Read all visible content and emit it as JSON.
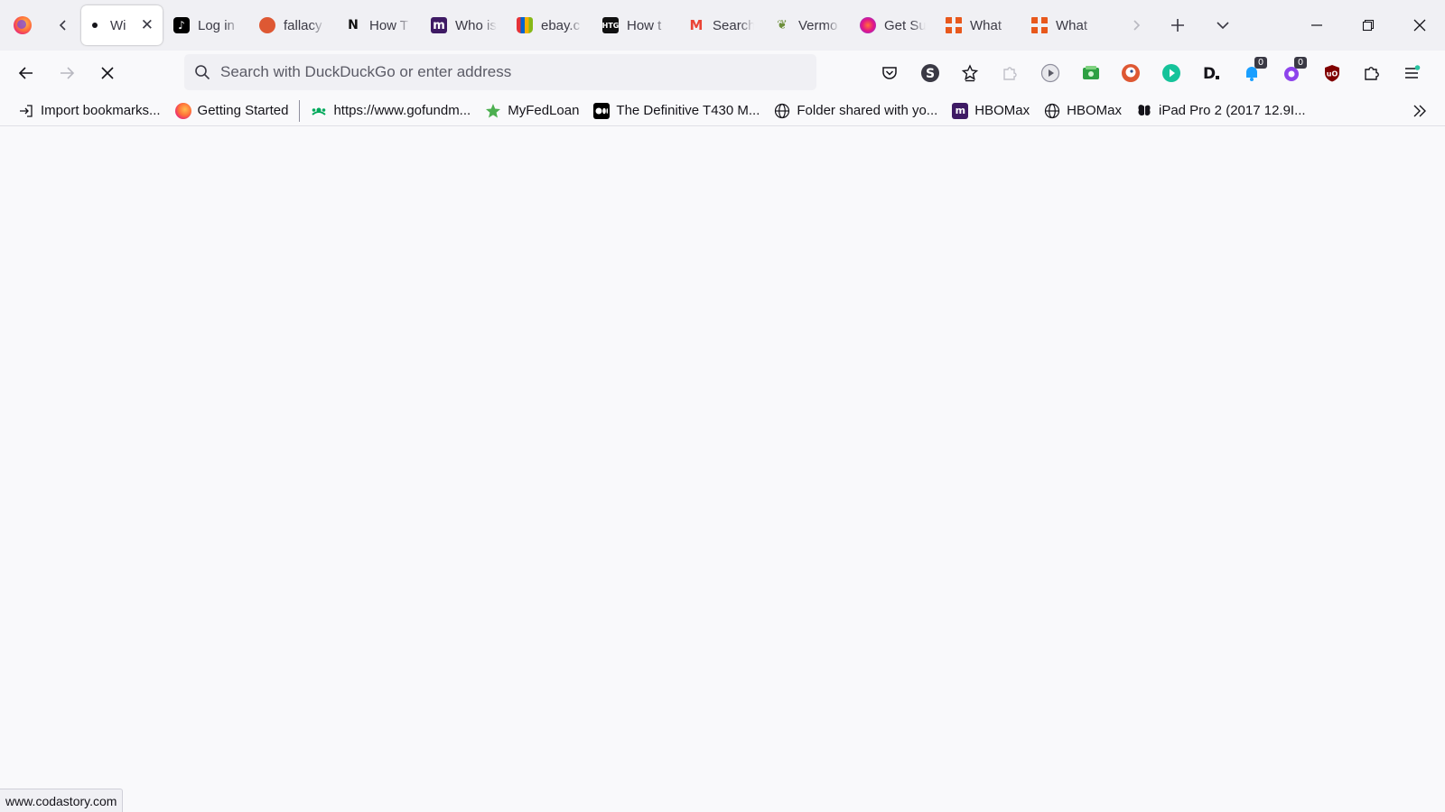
{
  "tabstrip": {
    "tabs": [
      {
        "title": "Wi",
        "active": true
      },
      {
        "title": "Log in",
        "icon": "tiktok-icon"
      },
      {
        "title": "fallacy",
        "icon": "duckduckgo-icon"
      },
      {
        "title": "How T",
        "icon": "nyt-icon"
      },
      {
        "title": "Who is",
        "icon": "meetup-icon"
      },
      {
        "title": "ebay.c",
        "icon": "ebay-icon"
      },
      {
        "title": "How t",
        "icon": "howtogeek-icon"
      },
      {
        "title": "Search",
        "icon": "gmail-icon"
      },
      {
        "title": "Vermo",
        "icon": "vermont-icon"
      },
      {
        "title": "Get Su",
        "icon": "firefox-icon"
      },
      {
        "title": "What",
        "icon": "grid-icon"
      },
      {
        "title": "What",
        "icon": "grid-icon"
      }
    ]
  },
  "favicons": {
    "tiktok": "♪",
    "nyt": "N",
    "meetup": "m",
    "htg": "HTG",
    "gmail": "M",
    "verm": "❦"
  },
  "navbar": {
    "url_placeholder": "Search with DuckDuckGo or enter address",
    "extension_badges": [
      "0",
      "0"
    ]
  },
  "bookmarks": [
    {
      "label": "Import bookmarks...",
      "icon": "import-icon"
    },
    {
      "label": "Getting Started",
      "icon": "firefox-icon"
    },
    {
      "label": "https://www.gofundm...",
      "icon": "gofundme-icon"
    },
    {
      "label": "MyFedLoan",
      "icon": "star-icon"
    },
    {
      "label": "The Definitive T430 M...",
      "icon": "medium-icon"
    },
    {
      "label": "Folder shared with yo...",
      "icon": "globe-icon"
    },
    {
      "label": "HBOMax",
      "icon": "meetup-icon"
    },
    {
      "label": "HBOMax",
      "icon": "globe-icon"
    },
    {
      "label": "iPad Pro 2 (2017 12.9I...",
      "icon": "butterfly-icon"
    }
  ],
  "status": {
    "url": "www.codastory.com"
  },
  "colors": {
    "tabstrip_bg": "#f0f0f4",
    "toolbar_bg": "#f9f9fb",
    "accent_ddg": "#de5833",
    "grid_orange": "#e8581c"
  }
}
